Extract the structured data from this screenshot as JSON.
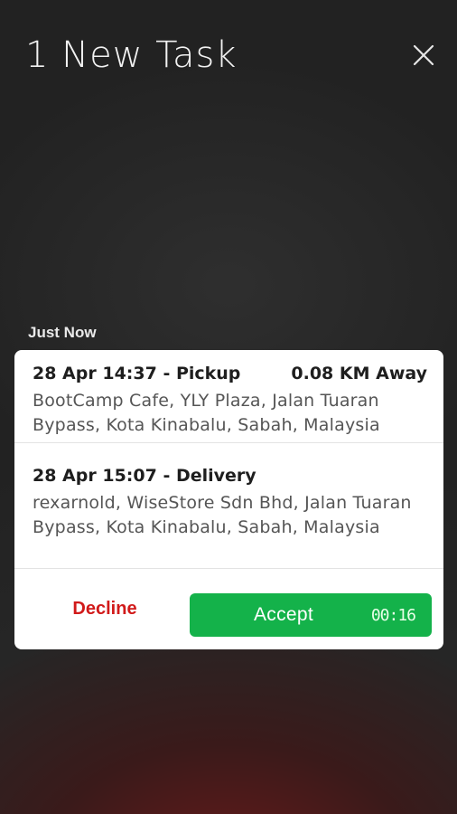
{
  "header": {
    "title": "1 New Task",
    "close_icon": "close-icon"
  },
  "task_group": {
    "label": "Just Now"
  },
  "task": {
    "pickup": {
      "time_type": "28 Apr 14:37 - Pickup",
      "distance": "0.08 KM Away",
      "address": "BootCamp Cafe, YLY Plaza, Jalan Tuaran Bypass, Kota Kinabalu, Sabah, Malaysia"
    },
    "delivery": {
      "time_type": "28 Apr 15:07 - Delivery",
      "address": "rexarnold, WiseStore Sdn Bhd, Jalan Tuaran Bypass, Kota Kinabalu, Sabah, Malaysia"
    },
    "actions": {
      "decline_label": "Decline",
      "accept_label": "Accept",
      "countdown": "00:16"
    }
  },
  "colors": {
    "accept": "#14b24a",
    "decline": "#d11a1a",
    "card": "#ffffff"
  }
}
